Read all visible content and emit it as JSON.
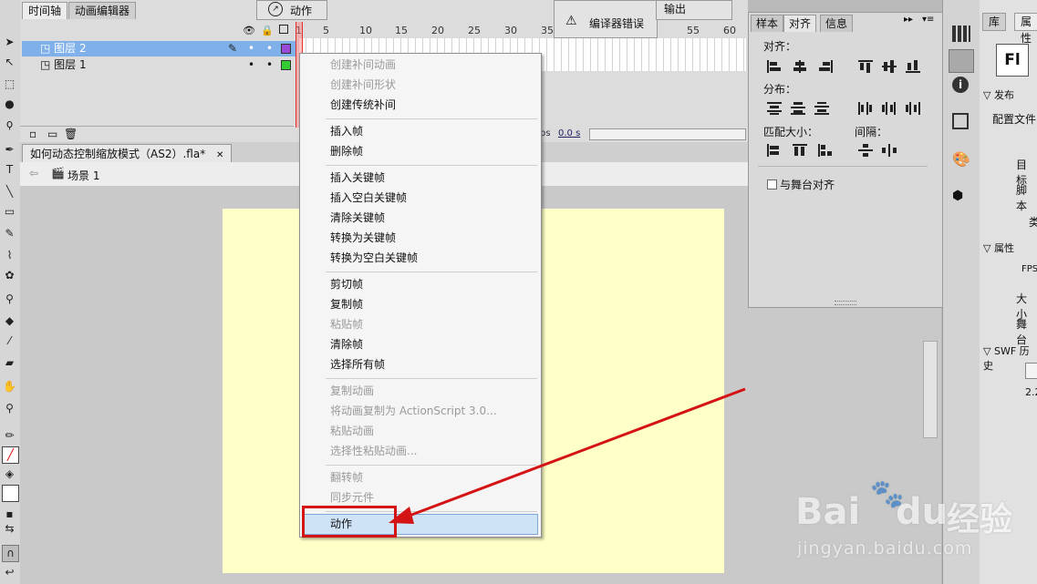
{
  "timeline": {
    "tabs": [
      "时间轴",
      "动画编辑器"
    ],
    "layers": [
      {
        "name": "图层 2",
        "color": "#9a4ad8",
        "selected": true
      },
      {
        "name": "图层 1",
        "color": "#33cc33",
        "selected": false
      }
    ],
    "ruler": [
      "1",
      "5",
      "10",
      "15",
      "20",
      "25",
      "30",
      "35",
      "55",
      "60"
    ],
    "fps_partial": "ps",
    "time": "0.0 s"
  },
  "floating": {
    "actions_title": "动作",
    "compiler_errors": "编译器错误",
    "output": "输出"
  },
  "document": {
    "tab_title": "如何动态控制缩放模式（AS2）.fla*",
    "scene": "场景 1"
  },
  "align_panel": {
    "tabs": [
      "样本",
      "对齐",
      "信息"
    ],
    "align_label": "对齐：",
    "distribute_label": "分布：",
    "match_size_label": "匹配大小：",
    "spacing_label": "间隔：",
    "to_stage_label": "与舞台对齐"
  },
  "right_panel": {
    "tabs": [
      "库",
      "属性"
    ],
    "logo": "Fl",
    "publish_section": "发布",
    "profile_label": "配置文件",
    "target_label": "目标",
    "script_label": "脚本",
    "class_label": "类",
    "props_section": "属性",
    "fps_label": "FPS",
    "size_label": "大小",
    "stage_label": "舞台",
    "swf_section": "SWF 历史",
    "swf_value": "2.2"
  },
  "context_menu": {
    "items": [
      {
        "label": "创建补间动画",
        "enabled": false
      },
      {
        "label": "创建补间形状",
        "enabled": false
      },
      {
        "label": "创建传统补间",
        "enabled": true
      },
      {
        "label": "插入帧",
        "enabled": true
      },
      {
        "label": "删除帧",
        "enabled": true
      },
      {
        "label": "插入关键帧",
        "enabled": true
      },
      {
        "label": "插入空白关键帧",
        "enabled": true
      },
      {
        "label": "清除关键帧",
        "enabled": true
      },
      {
        "label": "转换为关键帧",
        "enabled": true
      },
      {
        "label": "转换为空白关键帧",
        "enabled": true
      },
      {
        "label": "剪切帧",
        "enabled": true
      },
      {
        "label": "复制帧",
        "enabled": true
      },
      {
        "label": "粘贴帧",
        "enabled": false
      },
      {
        "label": "清除帧",
        "enabled": true
      },
      {
        "label": "选择所有帧",
        "enabled": true
      },
      {
        "label": "复制动画",
        "enabled": false
      },
      {
        "label": "将动画复制为 ActionScript 3.0...",
        "enabled": false
      },
      {
        "label": "粘贴动画",
        "enabled": false
      },
      {
        "label": "选择性粘贴动画...",
        "enabled": false
      },
      {
        "label": "翻转帧",
        "enabled": false
      },
      {
        "label": "同步元件",
        "enabled": false
      },
      {
        "label": "动作",
        "enabled": true,
        "highlighted": true
      }
    ]
  },
  "watermark": {
    "brand": "Bai",
    "brand2": "du",
    "cn": "经验",
    "url": "jingyan.baidu.com"
  },
  "colors": {
    "stage": "#ffffc8",
    "annotation_red": "#d41414",
    "menu_highlight": "#cfe3f7"
  }
}
